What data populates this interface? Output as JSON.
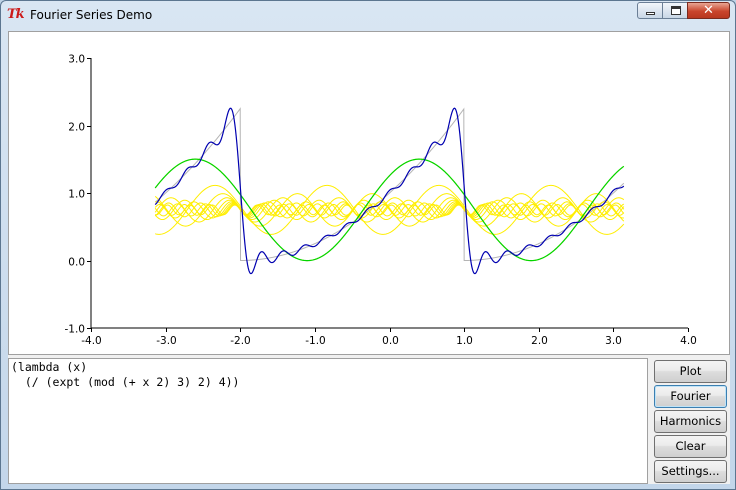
{
  "window": {
    "title": "Fourier Series Demo",
    "icon_text": "Tk",
    "icon_name": "tk-feather-icon"
  },
  "caption_buttons": {
    "minimize_icon": "minimize-icon",
    "maximize_icon": "maximize-icon",
    "close_icon": "close-icon",
    "close_glyph": "✕"
  },
  "plot": {
    "x_ticks": [
      "-4.0",
      "-3.0",
      "-2.0",
      "-1.0",
      "0.0",
      "1.0",
      "2.0",
      "3.0",
      "4.0"
    ],
    "y_ticks": [
      "3.0",
      "2.0",
      "1.0",
      "0.0",
      "-1.0"
    ],
    "colors": {
      "function": "#b4b4b4",
      "harmonics": "#ffee00",
      "first_term": "#00d400",
      "fourier_sum": "#0000b0"
    }
  },
  "chart_data": {
    "type": "line",
    "title": "",
    "xlabel": "",
    "ylabel": "",
    "xlim": [
      -4,
      4
    ],
    "ylim": [
      -1,
      3
    ],
    "x_ticks": [
      -4,
      -3,
      -2,
      -1,
      0,
      1,
      2,
      3,
      4
    ],
    "y_ticks": [
      -1,
      0,
      1,
      2,
      3
    ],
    "x_range": [
      -3.14,
      3.14
    ],
    "series": [
      {
        "kind": "function",
        "expression": "(/ (expt (mod (+ x 2) 3) 2) 4)"
      },
      {
        "kind": "harmonics",
        "count": 10
      },
      {
        "kind": "first_term",
        "terms": 1
      },
      {
        "kind": "fourier_sum",
        "terms": 10
      }
    ]
  },
  "editor": {
    "text": "(lambda (x)\n  (/ (expt (mod (+ x 2) 3) 2) 4))"
  },
  "buttons": {
    "plot": "Plot",
    "fourier": "Fourier",
    "harmonics": "Harmonics",
    "clear": "Clear",
    "settings": "Settings..."
  }
}
